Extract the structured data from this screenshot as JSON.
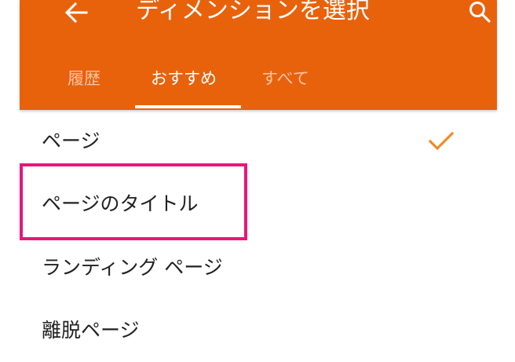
{
  "appbar": {
    "title": "ディメンションを選択",
    "back_icon": "arrow-back-icon",
    "search_icon": "search-icon",
    "background_color": "#e8620c"
  },
  "tabs": [
    {
      "label": "履歴",
      "selected": false
    },
    {
      "label": "おすすめ",
      "selected": true
    },
    {
      "label": "すべて",
      "selected": false
    }
  ],
  "items": [
    {
      "label": "ページ",
      "checked": true
    },
    {
      "label": "ページのタイトル",
      "checked": false,
      "highlighted": true
    },
    {
      "label": "ランディング ページ",
      "checked": false
    },
    {
      "label": "離脱ページ",
      "checked": false
    }
  ],
  "colors": {
    "accent": "#e8620c",
    "check": "#f08a24",
    "highlight_border": "#e8177a"
  }
}
